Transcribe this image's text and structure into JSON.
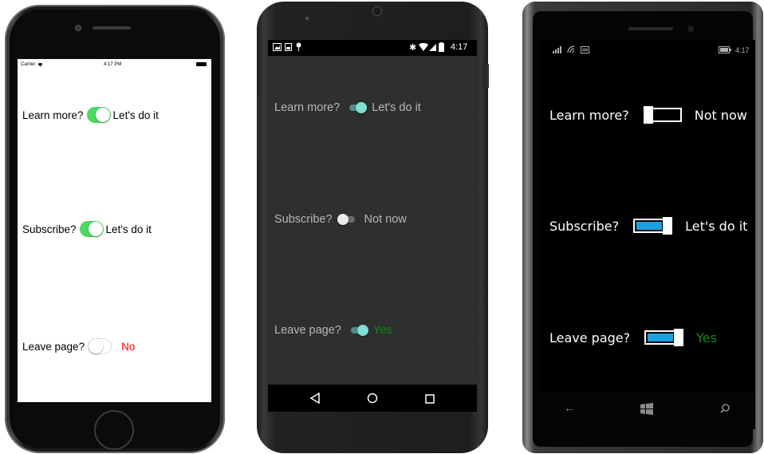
{
  "ios": {
    "status": {
      "carrier": "Carrier",
      "time": "4:17 PM"
    },
    "rows": [
      {
        "label": "Learn more?",
        "state": "on",
        "status": "Let's do it",
        "status_color": "#000000"
      },
      {
        "label": "Subscribe?",
        "state": "on",
        "status": "Let's do it",
        "status_color": "#000000"
      },
      {
        "label": "Leave page?",
        "state": "off",
        "status": "No",
        "status_color": "#ff0000"
      }
    ],
    "switch_on_color": "#4cd964"
  },
  "android": {
    "status": {
      "time": "4:17"
    },
    "rows": [
      {
        "label": "Learn more?",
        "state": "on",
        "status": "Let's do it",
        "status_color": "#b7b7b7"
      },
      {
        "label": "Subscribe?",
        "state": "off",
        "status": "Not now",
        "status_color": "#b7b7b7"
      },
      {
        "label": "Leave page?",
        "state": "on",
        "status": "Yes",
        "status_color": "#0b8a0b"
      }
    ],
    "accent_color": "#7fe0d3"
  },
  "windows_phone": {
    "status": {
      "time": "4:17"
    },
    "rows": [
      {
        "label": "Learn more?",
        "state": "off",
        "status": "Not now",
        "status_color": "#ffffff"
      },
      {
        "label": "Subscribe?",
        "state": "on",
        "status": "Let's do it",
        "status_color": "#ffffff"
      },
      {
        "label": "Leave page?",
        "state": "on",
        "status": "Yes",
        "status_color": "#138a13"
      }
    ],
    "accent_color": "#1ba1e2"
  }
}
